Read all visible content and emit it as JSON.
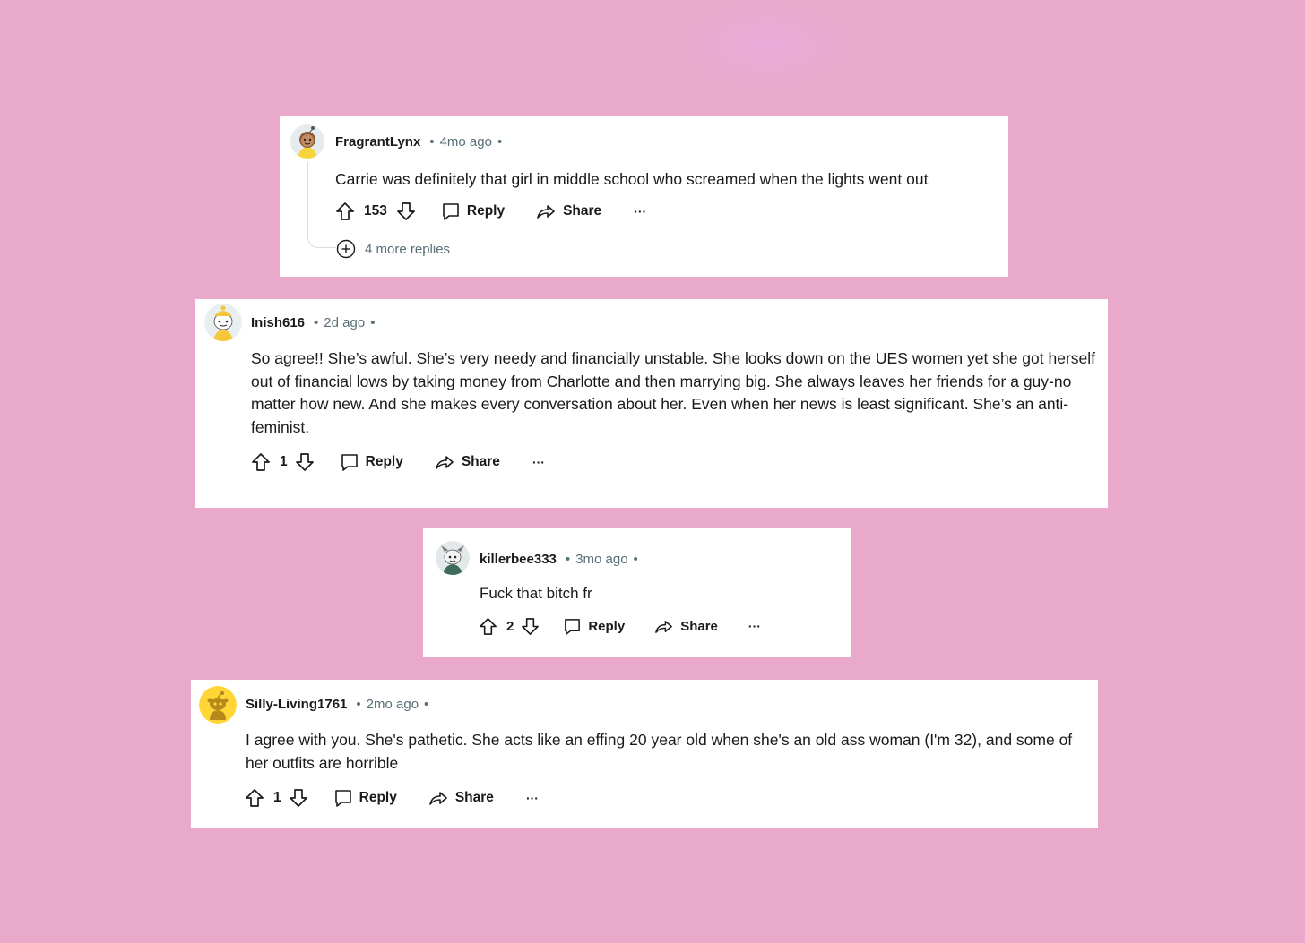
{
  "colors": {
    "background": "#e9a9cb",
    "card": "#ffffff",
    "text": "#1a1a1b",
    "meta": "#576f76"
  },
  "comments": [
    {
      "username": "FragrantLynx",
      "time": "4mo ago",
      "text": "Carrie was definitely that girl in middle school who screamed when the lights went out",
      "votes": "153",
      "reply_label": "Reply",
      "share_label": "Share",
      "more_label": "···",
      "more_replies": "4 more replies",
      "avatar_icon": "snoo-avatar-icon"
    },
    {
      "username": "Inish616",
      "time": "2d ago",
      "text": "So agree!! She’s awful. She’s very needy and financially unstable. She looks down on the UES women yet she got herself out of financial lows by taking money from Charlotte and then marrying big. She always leaves her friends for a guy-no matter how new. And she makes every conversation about her. Even when her news is least significant. She’s an anti-feminist.",
      "votes": "1",
      "reply_label": "Reply",
      "share_label": "Share",
      "more_label": "···",
      "avatar_icon": "snoo-avatar-icon"
    },
    {
      "username": "killerbee333",
      "time": "3mo ago",
      "text": "Fuck that bitch fr",
      "votes": "2",
      "reply_label": "Reply",
      "share_label": "Share",
      "more_label": "···",
      "avatar_icon": "snoo-avatar-icon"
    },
    {
      "username": "Silly-Living1761",
      "time": "2mo ago",
      "text": "I agree with you. She's pathetic. She acts like an effing 20 year old when she's an old ass woman (I'm 32), and some of her outfits are horrible",
      "votes": "1",
      "reply_label": "Reply",
      "share_label": "Share",
      "more_label": "···",
      "avatar_icon": "default-snoo-avatar-icon"
    }
  ]
}
